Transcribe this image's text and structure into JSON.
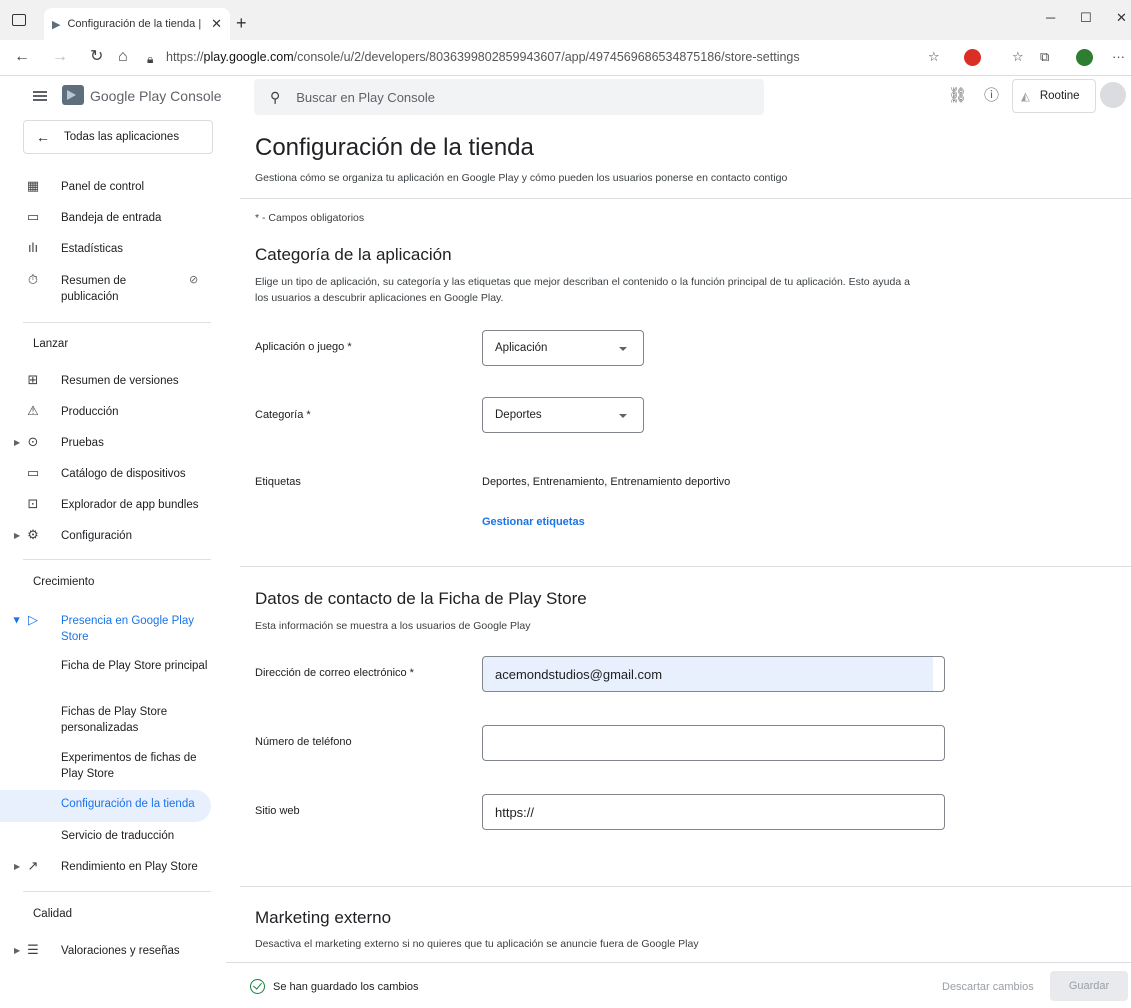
{
  "browser": {
    "tab_title": "Configuración de la tienda | Root",
    "url_prefix": "https://",
    "url_host": "play.google.com",
    "url_path": "/console/u/2/developers/8036399802859943607/app/4974569686534875186/store-settings"
  },
  "brand": {
    "name": "Google Play",
    "suffix": "Console"
  },
  "sidebar": {
    "all_apps": "Todas las aplicaciones",
    "top_items": [
      {
        "label": "Panel de control",
        "icon": "dashboard-icon"
      },
      {
        "label": "Bandeja de entrada",
        "icon": "inbox-icon"
      },
      {
        "label": "Estadísticas",
        "icon": "stats-icon"
      },
      {
        "label": "Resumen de publicación",
        "icon": "publishing-icon"
      }
    ],
    "launch_header": "Lanzar",
    "launch_items": [
      {
        "label": "Resumen de versiones",
        "icon": "releases-icon"
      },
      {
        "label": "Producción",
        "icon": "production-icon"
      },
      {
        "label": "Pruebas",
        "icon": "testing-icon"
      },
      {
        "label": "Catálogo de dispositivos",
        "icon": "devices-icon"
      },
      {
        "label": "Explorador de app bundles",
        "icon": "bundle-icon"
      },
      {
        "label": "Configuración",
        "icon": "settings-icon"
      }
    ],
    "growth_header": "Crecimiento",
    "presence": "Presencia en Google Play Store",
    "presence_sub": [
      "Ficha de Play Store principal",
      "Fichas de Play Store personalizadas",
      "Experimentos de fichas de Play Store",
      "Configuración de la tienda",
      "Servicio de traducción"
    ],
    "performance": "Rendimiento en Play Store",
    "quality_header": "Calidad",
    "reviews": "Valoraciones y reseñas"
  },
  "topbar": {
    "search_placeholder": "Buscar en Play Console",
    "developer": "Rootine"
  },
  "page": {
    "title": "Configuración de la tienda",
    "subtitle": "Gestiona cómo se organiza tu aplicación en Google Play y cómo pueden los usuarios ponerse en contacto contigo",
    "required_note": "* - Campos obligatorios"
  },
  "category_section": {
    "title": "Categoría de la aplicación",
    "desc_line1": "Elige un tipo de aplicación, su categoría y las etiquetas que mejor describan el contenido o la función principal de tu aplicación. Esto ayuda a",
    "desc_line2": "los usuarios a descubrir aplicaciones en Google Play.",
    "app_or_game_label": "Aplicación o juego  *",
    "app_or_game_value": "Aplicación",
    "category_label": "Categoría  *",
    "category_value": "Deportes",
    "tags_label": "Etiquetas",
    "tags_value": "Deportes, Entrenamiento, Entrenamiento deportivo",
    "manage_tags": "Gestionar etiquetas"
  },
  "contact_section": {
    "title": "Datos de contacto de la Ficha de Play Store",
    "desc": "Esta información se muestra a los usuarios de Google Play",
    "email_label": "Dirección de correo electrónico  *",
    "email_value": "acemondstudios@gmail.com",
    "phone_label": "Número de teléfono",
    "phone_value": "",
    "web_label": "Sitio web",
    "web_value": "https://"
  },
  "marketing_section": {
    "title": "Marketing externo",
    "desc": "Desactiva el marketing externo si no quieres que tu aplicación se anuncie fuera de Google Play"
  },
  "footer": {
    "saved_text": "Se han guardado los cambios",
    "discard": "Descartar cambios",
    "save": "Guardar"
  },
  "colors": {
    "accent": "#1a73e8",
    "active_bg": "#e8f0fe",
    "saved_green": "#188038"
  }
}
